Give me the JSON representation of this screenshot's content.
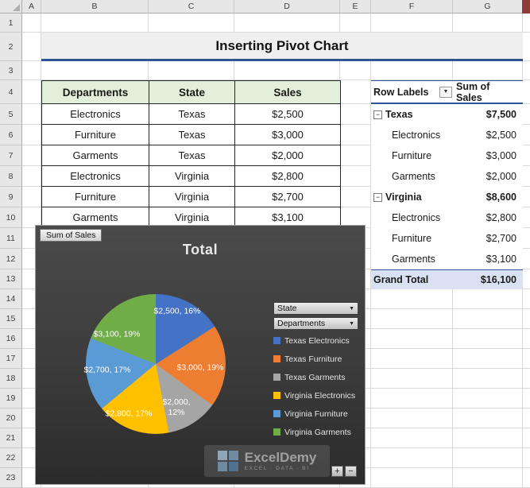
{
  "spreadsheet": {
    "column_headers": [
      "A",
      "B",
      "C",
      "D",
      "E",
      "F",
      "G"
    ],
    "row_headers": [
      "1",
      "2",
      "3",
      "4",
      "5",
      "6",
      "7",
      "8",
      "9",
      "10",
      "11",
      "12",
      "13",
      "14",
      "15",
      "16",
      "17",
      "18",
      "19",
      "20",
      "21",
      "22",
      "23"
    ]
  },
  "title": {
    "text": "Inserting Pivot Chart"
  },
  "icons": {
    "collapse": "−",
    "dropdown": "▼"
  },
  "data_table": {
    "headers": [
      "Departments",
      "State",
      "Sales"
    ],
    "rows": [
      [
        "Electronics",
        "Texas",
        "$2,500"
      ],
      [
        "Furniture",
        "Texas",
        "$3,000"
      ],
      [
        "Garments",
        "Texas",
        "$2,000"
      ],
      [
        "Electronics",
        "Virginia",
        "$2,800"
      ],
      [
        "Furniture",
        "Virginia",
        "$2,700"
      ],
      [
        "Garments",
        "Virginia",
        "$3,100"
      ]
    ]
  },
  "pivot_table": {
    "headers": [
      "Row Labels",
      "Sum of Sales"
    ],
    "rows": [
      {
        "label": "Texas",
        "value": "$7,500",
        "type": "group"
      },
      {
        "label": "Electronics",
        "value": "$2,500",
        "type": "item"
      },
      {
        "label": "Furniture",
        "value": "$3,000",
        "type": "item"
      },
      {
        "label": "Garments",
        "value": "$2,000",
        "type": "item"
      },
      {
        "label": "Virginia",
        "value": "$8,600",
        "type": "group"
      },
      {
        "label": "Electronics",
        "value": "$2,800",
        "type": "item"
      },
      {
        "label": "Furniture",
        "value": "$2,700",
        "type": "item"
      },
      {
        "label": "Garments",
        "value": "$3,100",
        "type": "item"
      },
      {
        "label": "Grand Total",
        "value": "$16,100",
        "type": "total"
      }
    ]
  },
  "chart": {
    "field_button": "Sum of Sales",
    "axis_buttons": [
      "State",
      "Departments"
    ],
    "legend": [
      {
        "label": "Texas Electronics",
        "color": "#4472C4"
      },
      {
        "label": "Texas Furniture",
        "color": "#ED7D31"
      },
      {
        "label": "Texas Garments",
        "color": "#A5A5A5"
      },
      {
        "label": "Virginia Electronics",
        "color": "#FFC000"
      },
      {
        "label": "Virginia Furniture",
        "color": "#5B9BD5"
      },
      {
        "label": "Virginia Garments",
        "color": "#70AD47"
      }
    ],
    "watermark": {
      "name": "ExcelDemy",
      "tagline": "EXCEL · DATA · BI"
    },
    "zoom_buttons": [
      "+",
      "−"
    ]
  },
  "chart_data": {
    "type": "pie",
    "title": "Total",
    "labels": [
      "Texas Electronics",
      "Texas Furniture",
      "Texas Garments",
      "Virginia Electronics",
      "Virginia Furniture",
      "Virginia Garments"
    ],
    "values": [
      2500,
      3000,
      2000,
      2800,
      2700,
      3100
    ],
    "percentages": [
      16,
      19,
      12,
      17,
      17,
      19
    ],
    "data_labels": [
      "$2,500, 16%",
      "$3,000, 19%",
      "$2,000, 12%",
      "$2,800, 17%",
      "$2,700, 17%",
      "$3,100, 19%"
    ],
    "colors": [
      "#4472C4",
      "#ED7D31",
      "#A5A5A5",
      "#FFC000",
      "#5B9BD5",
      "#70AD47"
    ],
    "background": "#3A3A3A",
    "legend_position": "right"
  }
}
